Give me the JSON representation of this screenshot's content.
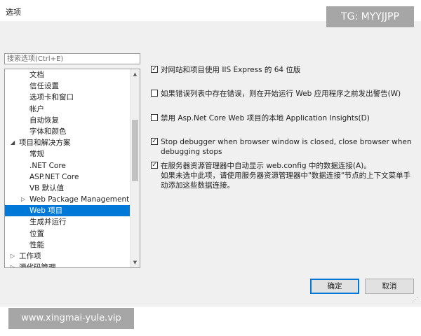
{
  "watermarks": {
    "top": "TG: MYYJJPP",
    "bottom": "www.xingmai-yule.vip"
  },
  "window": {
    "title": "选项",
    "help_glyph": "?",
    "close_glyph": "✕"
  },
  "search": {
    "placeholder": "搜索选项(Ctrl+E)"
  },
  "tree": {
    "items": [
      {
        "label": "文档",
        "indent": 2
      },
      {
        "label": "信任设置",
        "indent": 2
      },
      {
        "label": "选项卡和窗口",
        "indent": 2
      },
      {
        "label": "帐户",
        "indent": 2
      },
      {
        "label": "自动恢复",
        "indent": 2
      },
      {
        "label": "字体和颜色",
        "indent": 2
      },
      {
        "label": "项目和解决方案",
        "indent": 1,
        "arrow": "expanded"
      },
      {
        "label": "常规",
        "indent": 2
      },
      {
        "label": ".NET Core",
        "indent": 2
      },
      {
        "label": "ASP.NET Core",
        "indent": 2
      },
      {
        "label": "VB 默认值",
        "indent": 2
      },
      {
        "label": "Web Package Management",
        "indent": 2,
        "arrow": "collapsed"
      },
      {
        "label": "Web 项目",
        "indent": 2,
        "selected": true
      },
      {
        "label": "生成并运行",
        "indent": 2
      },
      {
        "label": "位置",
        "indent": 2
      },
      {
        "label": "性能",
        "indent": 2
      },
      {
        "label": "工作项",
        "indent": 1,
        "arrow": "collapsed"
      },
      {
        "label": "源代码管理",
        "indent": 1,
        "arrow": "collapsed"
      }
    ]
  },
  "options": [
    {
      "checked": true,
      "text": "对网站和项目使用 IIS Express 的 64 位版"
    },
    {
      "checked": false,
      "text": "如果错误列表中存在错误，则在开始运行 Web 应用程序之前发出警告(W)"
    },
    {
      "checked": false,
      "text": "禁用 Asp.Net Core Web 项目的本地 Application Insights(D)"
    },
    {
      "checked": true,
      "text": "Stop debugger when browser window is closed, close browser when debugging stops"
    },
    {
      "checked": true,
      "text": "在服务器资源管理器中自动显示 web.config 中的数据连接(A)。",
      "note": "如果未选中此项，请使用服务器资源管理器中\"数据连接\"节点的上下文菜单手动添加这些数据连接。"
    }
  ],
  "buttons": {
    "ok": "确定",
    "cancel": "取消"
  },
  "colors": {
    "selection": "#0078d7",
    "dialog_bg": "#f0f0f0"
  }
}
